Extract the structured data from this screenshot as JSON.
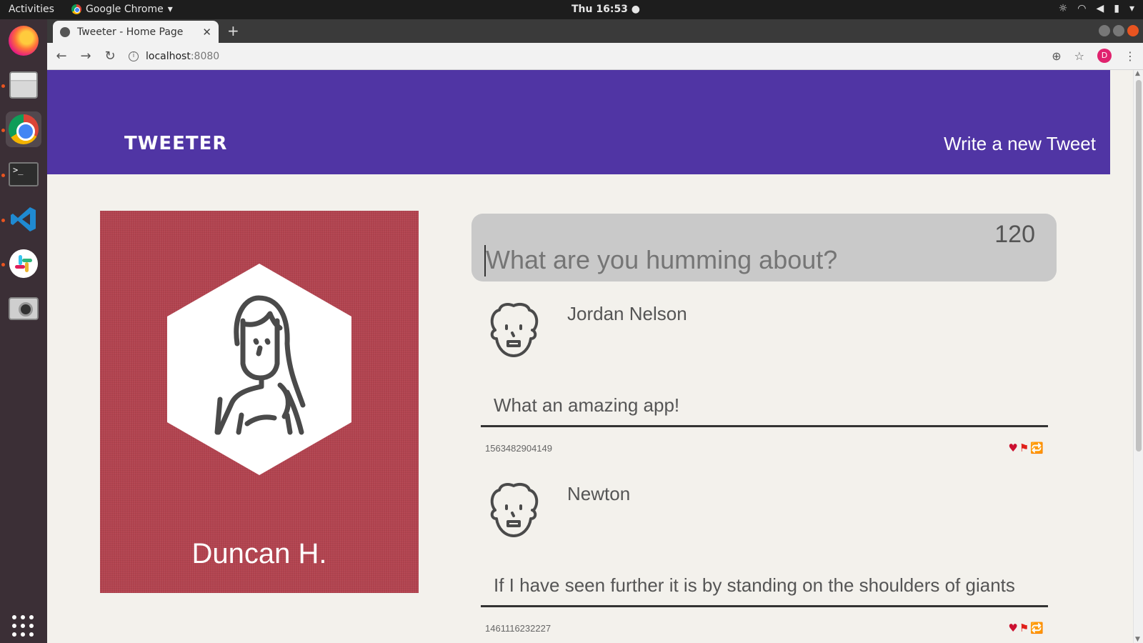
{
  "os": {
    "activities_label": "Activities",
    "app_menu_label": "Google Chrome",
    "app_menu_arrow": "▾",
    "clock": "Thu 16:53 ●"
  },
  "browser": {
    "tab_title": "Tweeter - Home Page",
    "tab_close": "✕",
    "new_tab": "+",
    "url_host": "localhost",
    "url_port": ":8080",
    "profile_initial": "D"
  },
  "site": {
    "brand": "TWEETER",
    "nav_compose_label": "Write a new Tweet",
    "accent_color": "#5035a4",
    "profile_card_color": "#b2434f"
  },
  "profile": {
    "name": "Duncan H."
  },
  "composer": {
    "placeholder": "What are you humming about?",
    "counter": "120"
  },
  "tweets": [
    {
      "author": "Jordan Nelson",
      "content": "What an amazing app!",
      "timestamp": "1563482904149"
    },
    {
      "author": "Newton",
      "content": "If I have seen further it is by standing on the shoulders of giants",
      "timestamp": "1461116232227"
    }
  ],
  "tweet_actions": {
    "like_icon": "♥",
    "flag_icon": "⚑",
    "retweet_icon": "🔁"
  }
}
